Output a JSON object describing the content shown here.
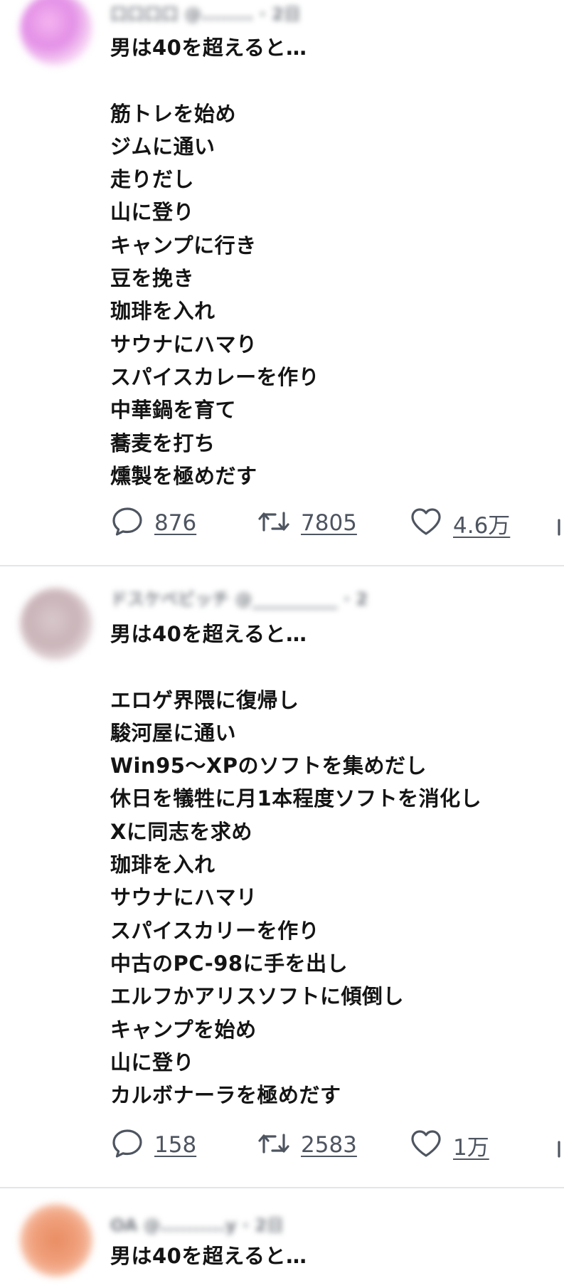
{
  "tweets": [
    {
      "author_blurred": "口口口口 @........ · 2日",
      "lines": [
        "男は40を超えると…",
        "",
        "筋トレを始め",
        "ジムに通い",
        "走りだし",
        "山に登り",
        "キャンプに行き",
        "豆を挽き",
        "珈琲を入れ",
        "サウナにハマり",
        "スパイスカレーを作り",
        "中華鍋を育て",
        "蕎麦を打ち",
        "燻製を極めだす"
      ],
      "replies": "876",
      "retweets": "7805",
      "likes": "4.6万"
    },
    {
      "author_blurred": "ドスケベビッチ @__________ · 2",
      "lines": [
        "男は40を超えると…",
        "",
        "エロゲ界隈に復帰し",
        "駿河屋に通い",
        "Win95〜XPのソフトを集めだし",
        "休日を犠牲に月1本程度ソフトを消化し",
        "Xに同志を求め",
        "珈琲を入れ",
        "サウナにハマリ",
        "スパイスカリーを作り",
        "中古のPC-98に手を出し",
        "エルフかアリスソフトに傾倒し",
        "キャンプを始め",
        "山に登り",
        "カルボナーラを極めだす"
      ],
      "replies": "158",
      "retweets": "2583",
      "likes": "1万"
    },
    {
      "author_blurred": "OA @..........y · 2日",
      "lines": [
        "男は40を超えると…"
      ]
    }
  ],
  "icons": {
    "reply": "reply-icon",
    "retweet": "retweet-icon",
    "like": "heart-icon",
    "share": "share-icon"
  },
  "colors": {
    "text": "#141414",
    "icon": "#4e5560",
    "divider": "#e3e5e8"
  }
}
